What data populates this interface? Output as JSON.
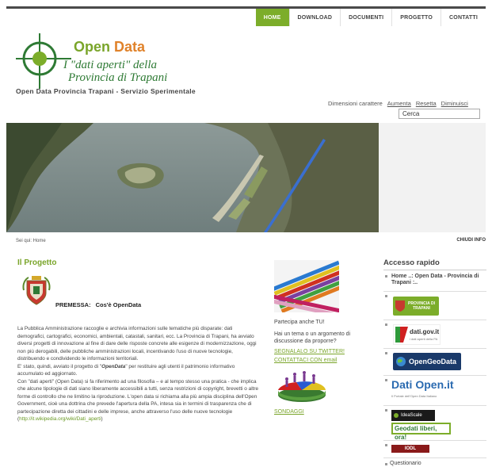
{
  "nav": {
    "items": [
      "HOME",
      "DOWNLOAD",
      "DOCUMENTI",
      "PROGETTO",
      "CONTATTI"
    ],
    "active": "HOME"
  },
  "logo": {
    "title_open": "Open",
    "title_data": "Data",
    "subtitle_line1": "I \"dati aperti\" della",
    "subtitle_line2": "Provincia di Trapani"
  },
  "tagline": "Open Data Provincia Trapani - Servizio Sperimentale",
  "font_controls": {
    "label": "Dimensioni carattere",
    "increase": "Aumenta",
    "reset": "Resetta",
    "decrease": "Diminuisci"
  },
  "search": {
    "value": "Cerca"
  },
  "breadcrumb": "Sei qui: Home",
  "close_info": "CHIUDI INFO",
  "main": {
    "title": "Il Progetto",
    "premessa_label": "PREMESSA:",
    "premessa_text": "Cos'è OpenData",
    "p1": "La Pubblica Amministrazione raccoglie e archivia informazioni sulle tematiche più disparate: dati demografici, cartografici, economici, ambientali, catastali, sanitari, ecc. La Provincia di Trapani, ha avviato diversi progetti di innovazione al fine di dare delle risposte concrete alle esigenze di modernizzazione, oggi non più derogabili, delle pubbliche amministrazioni locali, incentivando l'uso di nuove tecnologie, distribuendo e condividendo le informazioni territoriali.",
    "p2_a": "E' stato, quindi, avviato il progetto di \"",
    "p2_em": "OpenData",
    "p2_b": "\" per restituire agli utenti il patrimonio informativo accumulato ed aggiornato.",
    "p3": "Con \"dati aperti\" (Open Data) si fa riferimento ad una filosofia – e al tempo stesso una pratica - che implica che alcune tipologie di dati siano liberamente accessibili a tutti, senza restrizioni di copyright, brevetti o altre forme di controllo che ne limitino la riproduzione. L'open data si richiama alla più ampia disciplina dell'Open Government, cioè una dottrina che prevede l'apertura della PA, intesa sia in termini di trasparenza che di partecipazione diretta dei cittadini e delle imprese, anche attraverso l'uso delle nuove tecnologie (",
    "p3_link": "http://it.wikipedia.org/wiki/Dati_aperti",
    "p3_end": ")"
  },
  "middle": {
    "partecipa": "Partecipa anche TU!",
    "question": "Hai un tema o un argomento di discussione da proporre?",
    "twitter_link": "SEGNALALO SU TWITTER!",
    "email_link": "CONTATTACI CON email",
    "survey_link": "SONDAGGI"
  },
  "right": {
    "title": "Accesso rapido",
    "home_link": "Home ..: Open Data - Provincia di Trapani :..",
    "provincia_label1": "PROVINCIA DI",
    "provincia_label2": "TRAPANI",
    "datigov": "dati.gov.it",
    "datigov_sub": "i dati aperti della PA",
    "opengeodata": "OpenGeoData",
    "datiopen_a": "Dati ",
    "datiopen_b": "Open",
    "datiopen_c": ".it",
    "datiopen_sub": "Il Portale dell'Open Data Italiano",
    "ideascale": "IdeaScale",
    "geodati": "Geodati liberi, ora!",
    "iodl": "IODL",
    "questionario": "Questionario"
  },
  "colors": {
    "accent_green": "#7cad2a",
    "nav_text": "#444444",
    "title_orange": "#e0822a"
  }
}
